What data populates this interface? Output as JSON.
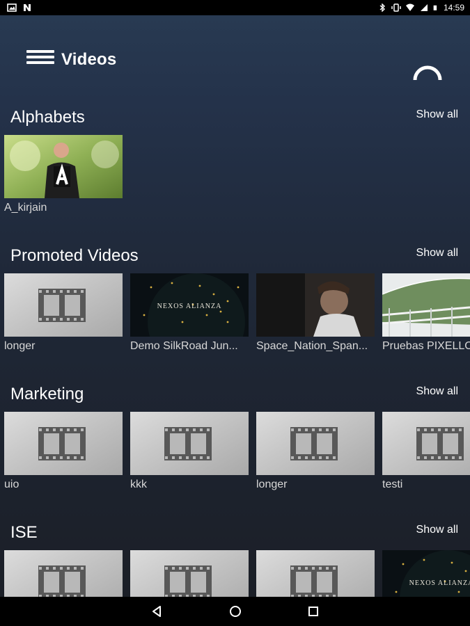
{
  "status_bar": {
    "time": "14:59",
    "left_icons": [
      "image-icon",
      "n-icon"
    ],
    "right_icons": [
      "bluetooth-icon",
      "vibrate-icon",
      "wifi-icon",
      "signal-icon",
      "battery-icon"
    ]
  },
  "app_bar": {
    "title": "Videos",
    "menu_icon": "menu-icon",
    "refresh_icon": "refresh-icon"
  },
  "show_all_label": "Show all",
  "sections": [
    {
      "title": "Alphabets",
      "videos": [
        {
          "label": "A_kirjain",
          "thumb": "alphabet-presenter"
        }
      ]
    },
    {
      "title": "Promoted Videos",
      "videos": [
        {
          "label": "longer",
          "thumb": "placeholder"
        },
        {
          "label": "Demo SilkRoad Jun...",
          "thumb": "nexos-alianza",
          "thumb_text": "NEXOS ALIANZA"
        },
        {
          "label": "Space_Nation_Span...",
          "thumb": "child"
        },
        {
          "label": "Pruebas PIXELLOT",
          "thumb": "soccer-field"
        }
      ]
    },
    {
      "title": "Marketing",
      "videos": [
        {
          "label": "uio",
          "thumb": "placeholder"
        },
        {
          "label": "kkk",
          "thumb": "placeholder"
        },
        {
          "label": "longer",
          "thumb": "placeholder"
        },
        {
          "label": "testi",
          "thumb": "placeholder"
        }
      ]
    },
    {
      "title": "ISE",
      "videos": [
        {
          "label": "",
          "thumb": "placeholder"
        },
        {
          "label": "",
          "thumb": "placeholder"
        },
        {
          "label": "",
          "thumb": "placeholder"
        },
        {
          "label": "",
          "thumb": "nexos-alianza",
          "thumb_text": "NEXOS ALIANZA"
        }
      ]
    }
  ],
  "nav_bar": {
    "buttons": [
      "back-icon",
      "home-icon",
      "recents-icon"
    ]
  }
}
